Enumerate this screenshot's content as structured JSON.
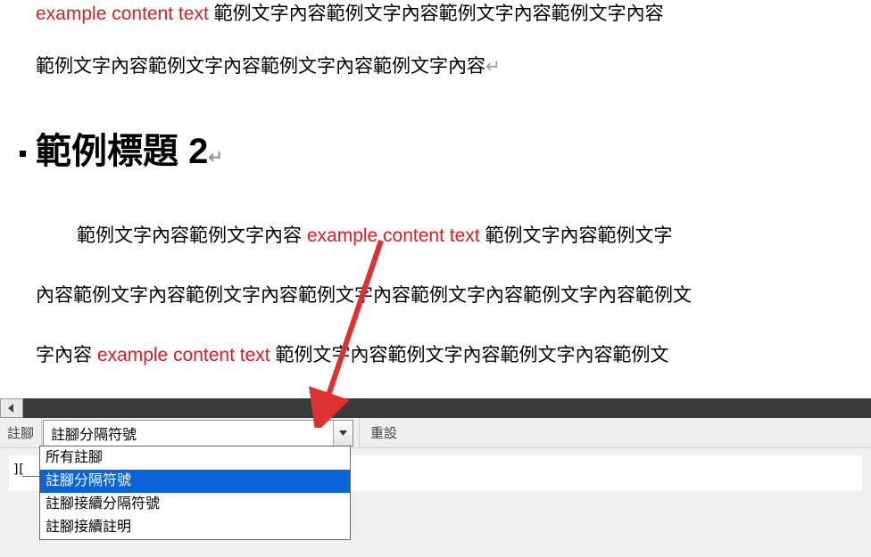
{
  "doc": {
    "line1_red": "example content text",
    "line1_rest": " 範例文字內容範例文字內容範例文字內容範例文字內容",
    "line2": "範例文字內容範例文字內容範例文字內容範例文字內容",
    "heading": "範例標題 2",
    "p2_a": "範例文字內容範例文字內容 ",
    "p2_red1": "example content text",
    "p2_b": " 範例文字內容範例文字",
    "p2_line2": "內容範例文字內容範例文字內容範例文字內容範例文字內容範例文字內容範例文",
    "p2_c": "字內容 ",
    "p2_red2": "example content text",
    "p2_d": " 範例文字內容範例文字內容範例文字內容範例文",
    "para_mark": "↵"
  },
  "footnote": {
    "label": "註腳",
    "selected": "註腳分隔符號",
    "reset": "重設",
    "options": [
      "所有註腳",
      "註腳分隔符號",
      "註腳接續分隔符號",
      "註腳接續註明"
    ],
    "highlighted_index": 1,
    "separator_glyph": "][________________"
  }
}
